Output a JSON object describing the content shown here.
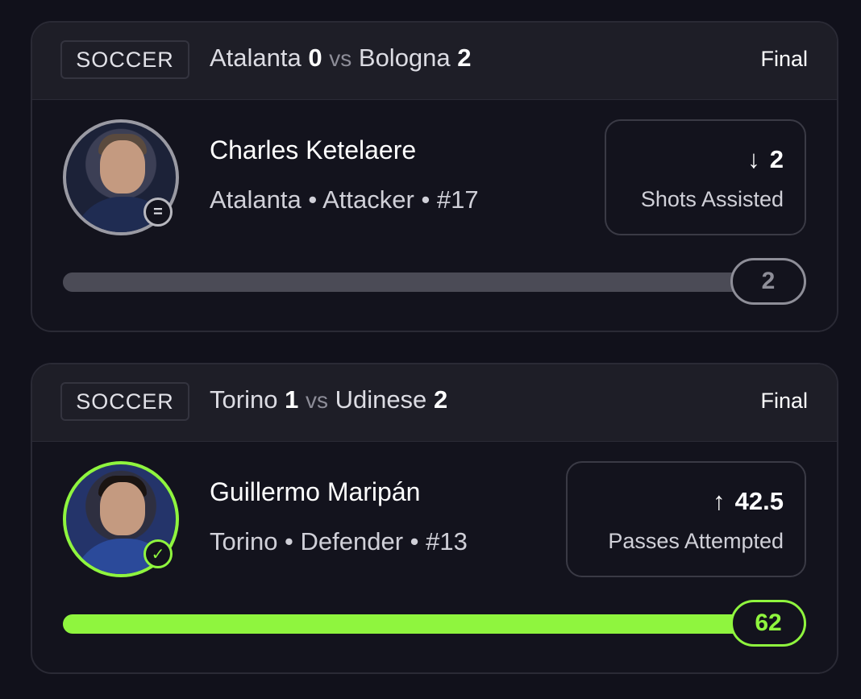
{
  "colors": {
    "neutral_fill": "#4b4b56",
    "success_fill": "#8ff53e"
  },
  "cards": [
    {
      "sport": "SOCCER",
      "home_team": "Atalanta",
      "home_score": "0",
      "vs": "vs",
      "away_team": "Bologna",
      "away_score": "2",
      "status": "Final",
      "player_name": "Charles Ketelaere",
      "player_meta": "Atalanta • Attacker • #17",
      "avatar_badge_icon": "equals-circle-icon",
      "avatar_badge_glyph": "=",
      "direction_icon": "arrow-down-icon",
      "direction_glyph": "↓",
      "line": "2",
      "stat_label": "Shots Assisted",
      "actual": "2",
      "progress": 1.0,
      "result": "push"
    },
    {
      "sport": "SOCCER",
      "home_team": "Torino",
      "home_score": "1",
      "vs": "vs",
      "away_team": "Udinese",
      "away_score": "2",
      "status": "Final",
      "player_name": "Guillermo Maripán",
      "player_meta": "Torino • Defender • #13",
      "avatar_badge_icon": "check-circle-icon",
      "avatar_badge_glyph": "✓",
      "direction_icon": "arrow-up-icon",
      "direction_glyph": "↑",
      "line": "42.5",
      "stat_label": "Passes Attempted",
      "actual": "62",
      "progress": 1.0,
      "result": "win"
    }
  ]
}
